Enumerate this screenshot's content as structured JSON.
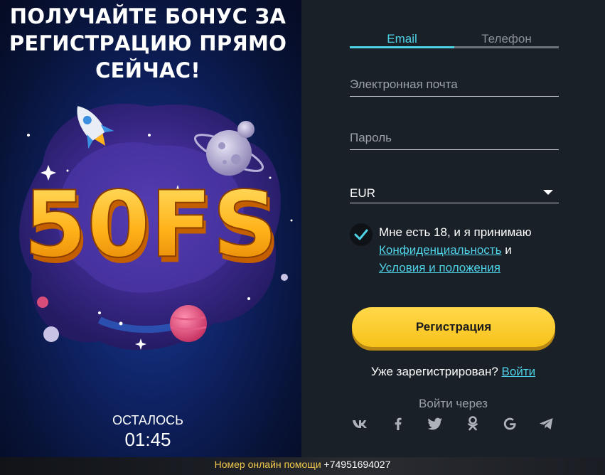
{
  "promo": {
    "title": "ПОЛУЧАЙТЕ БОНУС ЗА РЕГИСТРАЦИЮ ПРЯМО СЕЙЧАС!",
    "badge": "50FS",
    "timer_label": "ОСТАЛОСЬ",
    "timer_value": "01:45"
  },
  "form": {
    "tabs": [
      {
        "label": "Email",
        "active": true
      },
      {
        "label": "Телефон",
        "active": false
      }
    ],
    "email": {
      "placeholder": "Электронная почта",
      "value": ""
    },
    "password": {
      "placeholder": "Пароль",
      "value": ""
    },
    "currency": {
      "selected": "EUR"
    },
    "terms": {
      "checked": true,
      "text": "Мне есть 18, и я принимаю",
      "privacy_link": "Конфиденциальность",
      "conjunction": "и",
      "terms_link": "Условия и положения"
    },
    "register_label": "Регистрация",
    "already_text": "Уже зарегистрирован?",
    "login_link": "Войти",
    "social_title": "Войти через",
    "socials": [
      "vk-icon",
      "facebook-icon",
      "twitter-icon",
      "odnoklassniki-icon",
      "google-icon",
      "telegram-icon"
    ]
  },
  "footer": {
    "label": "Номер онлайн помощи",
    "phone": "+74951694027"
  },
  "colors": {
    "accent": "#4fd1e6",
    "button": "#f7c21a",
    "panel": "#1a2027"
  }
}
